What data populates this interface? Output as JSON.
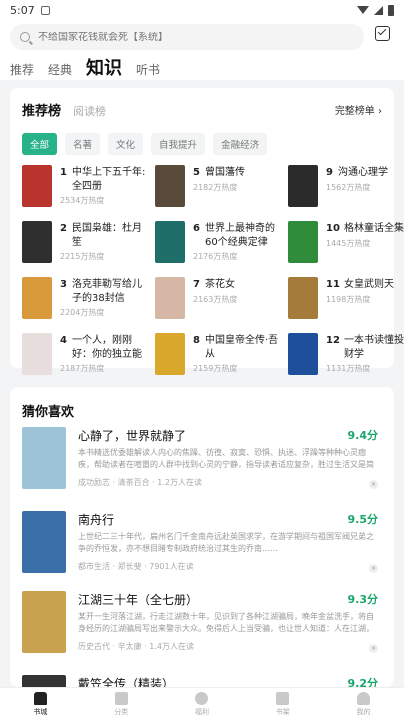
{
  "status": {
    "time": "5:07"
  },
  "search": {
    "placeholder": "不给国家花钱就会死【系统】"
  },
  "tabs": [
    "推荐",
    "经典",
    "知识",
    "听书"
  ],
  "ranking": {
    "title": "推荐榜",
    "subtitle": "阅读榜",
    "more": "完整榜单 ›",
    "chips": [
      "全部",
      "名著",
      "文化",
      "自我提升",
      "金融经济"
    ],
    "items": [
      {
        "num": "1",
        "name": "中华上下五千年: 全四册",
        "heat": "2534万热度",
        "color": "#b8342c"
      },
      {
        "num": "2",
        "name": "民国枭雄：杜月笙",
        "heat": "2215万热度",
        "color": "#2f2f2f"
      },
      {
        "num": "3",
        "name": "洛克菲勒写给儿子的38封信",
        "heat": "2204万热度",
        "color": "#d99a3c"
      },
      {
        "num": "4",
        "name": "一个人，刚刚好：你的独立能力...",
        "heat": "2187万热度",
        "color": "#e9dede"
      },
      {
        "num": "5",
        "name": "曾国藩传",
        "heat": "2182万热度",
        "color": "#5a4a3a"
      },
      {
        "num": "6",
        "name": "世界上最神奇的60个经典定律",
        "heat": "2176万热度",
        "color": "#1f6e6a"
      },
      {
        "num": "7",
        "name": "茶花女",
        "heat": "2163万热度",
        "color": "#d6b7a6"
      },
      {
        "num": "8",
        "name": "中国皇帝全传·吾从",
        "heat": "2159万热度",
        "color": "#d9a72b"
      },
      {
        "num": "9",
        "name": "沟通心理学",
        "heat": "1562万热度",
        "color": "#2b2b2b"
      },
      {
        "num": "10",
        "name": "格林童话全集",
        "heat": "1445万热度",
        "color": "#2f8c3a"
      },
      {
        "num": "11",
        "name": "女皇武则天",
        "heat": "1198万热度",
        "color": "#a47b3b"
      },
      {
        "num": "12",
        "name": "一本书读懂投资财学",
        "heat": "1131万热度",
        "color": "#1d4f9a"
      }
    ]
  },
  "guess": {
    "title": "猜你喜欢",
    "books": [
      {
        "title": "心静了，世界就静了",
        "score": "9.4分",
        "desc": "本书精选优委雄解读人内心的焦躁、彷徨、寂寞、恐惧、执迷、浮躁等种种心灵痼疾，帮助读者在喧嚣的人群中找到心灵的宁静，指导读者适应复杂，胜过生活又是简单纯粹，每一个看似深长的故事。",
        "meta": "成功励志 · 清茶百合 · 1.2万人在读",
        "color": "#9dc4d6"
      },
      {
        "title": "南舟行",
        "score": "9.5分",
        "desc": "上世纪二三十年代，扁州名门千金南舟远赴英国求学，在游学期间与祖国军阀兄弟之争的乔恒发，亦不想目睹专制政府统治过其生的乔南……",
        "meta": "都市生活 · 郑长斐 · 7901人在读",
        "color": "#3b6fa8"
      },
      {
        "title": "江湖三十年（全七册）",
        "score": "9.3分",
        "desc": "某开一生河落江湖，行走江湖数十年，见识到了各种江湖骗局，晚年金盆洗手，将自身经历的江湖骗局写出来警示大众。免得后人上当受骗，也让世人知道：人在江湖，身不由己。",
        "meta": "历史古代 · 辛太康 · 1.4万人在读",
        "color": "#c9a24f"
      },
      {
        "title": "戴笠全传（精装）",
        "score": "9.2分",
        "desc": "",
        "meta": "",
        "color": "#333333"
      }
    ]
  },
  "nav": {
    "items": [
      {
        "label": "书城",
        "icon": "home-icon"
      },
      {
        "label": "分类",
        "icon": "category-icon"
      },
      {
        "label": "福利",
        "icon": "gift-icon"
      },
      {
        "label": "书架",
        "icon": "bookshelf-icon"
      },
      {
        "label": "我的",
        "icon": "profile-icon"
      }
    ]
  }
}
